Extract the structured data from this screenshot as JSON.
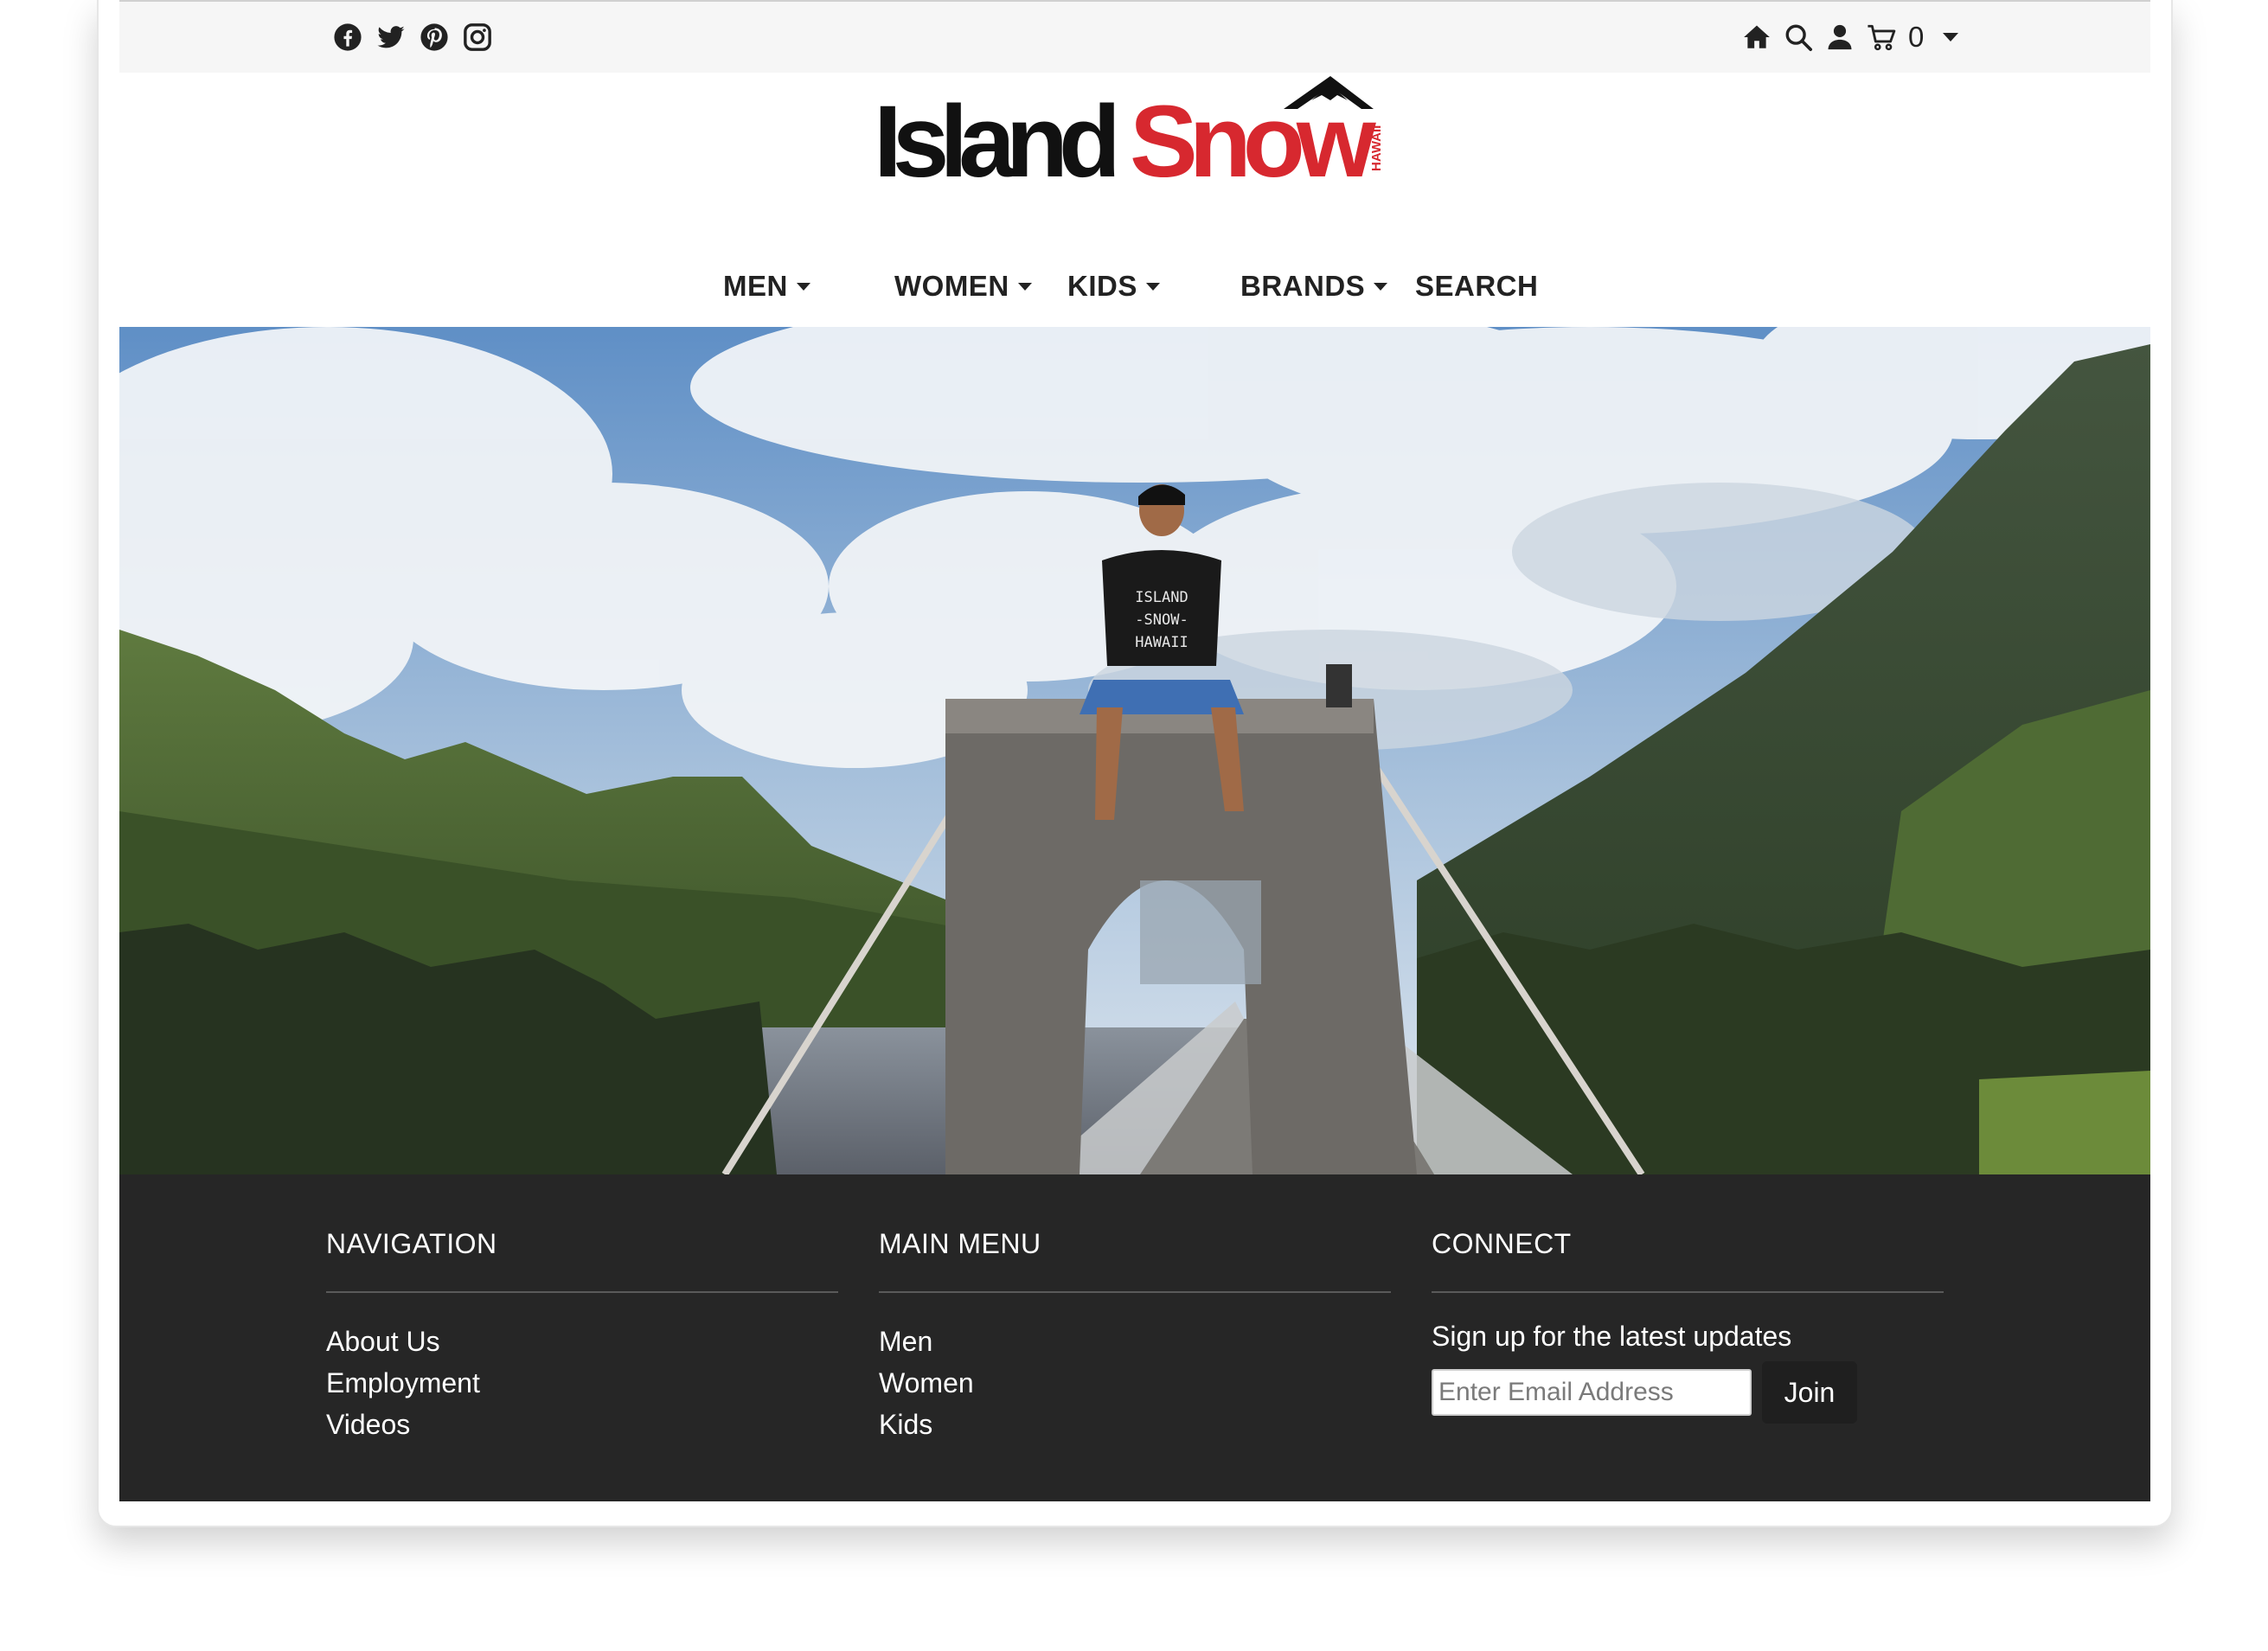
{
  "header": {
    "social_icons": [
      "facebook-icon",
      "twitter-icon",
      "pinterest-icon",
      "instagram-icon"
    ],
    "utility_icons": [
      "home-icon",
      "search-icon",
      "user-icon",
      "cart-icon"
    ],
    "cart_count": "0"
  },
  "logo": {
    "part1": "Island",
    "part2": "Snow",
    "tagline": "HAWAII",
    "colors": {
      "island": "#111111",
      "snow": "#d7282f"
    }
  },
  "nav": {
    "items": [
      {
        "label": "MEN",
        "has_dropdown": true
      },
      {
        "label": "WOMEN",
        "has_dropdown": true
      },
      {
        "label": "KIDS",
        "has_dropdown": true
      },
      {
        "label": "BRANDS",
        "has_dropdown": true
      },
      {
        "label": "SEARCH",
        "has_dropdown": false
      }
    ]
  },
  "hero": {
    "shirt_text": [
      "ISLAND",
      "-SNOW-",
      "HAWAII"
    ]
  },
  "footer": {
    "navigation": {
      "heading": "NAVIGATION",
      "links": [
        "About Us",
        "Employment",
        "Videos"
      ]
    },
    "main_menu": {
      "heading": "MAIN MENU",
      "links": [
        "Men",
        "Women",
        "Kids"
      ]
    },
    "connect": {
      "heading": "CONNECT",
      "subtitle": "Sign up for the latest updates",
      "email_placeholder": "Enter Email Address",
      "join_label": "Join"
    },
    "background": "#262626"
  }
}
